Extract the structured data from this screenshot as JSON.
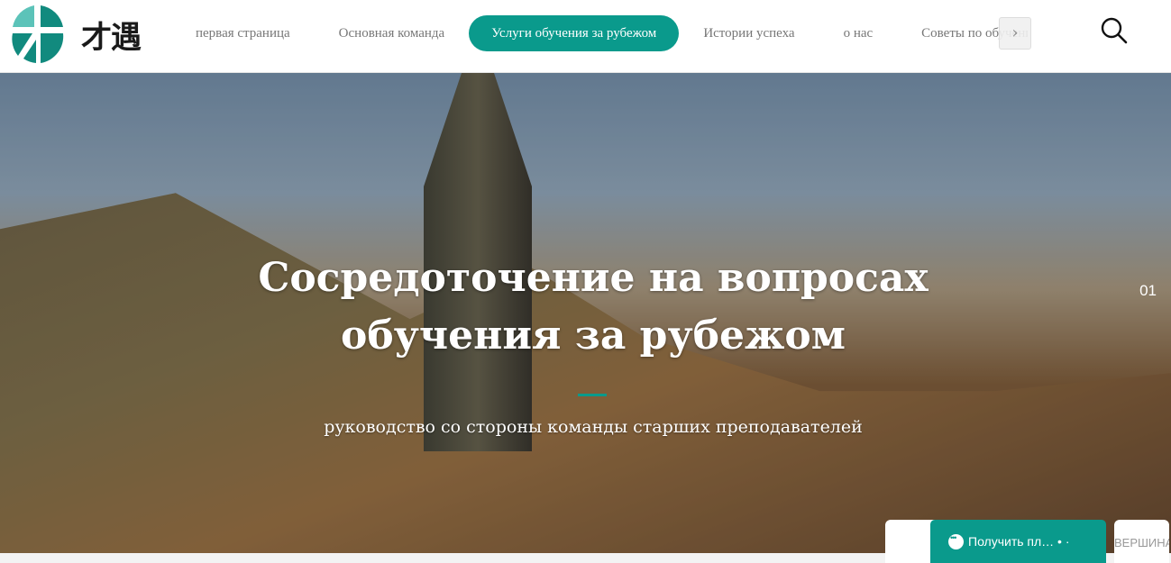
{
  "header": {
    "logo_text": "才遇",
    "nav": [
      {
        "label": "первая страница",
        "active": false
      },
      {
        "label": "Основная команда",
        "active": false
      },
      {
        "label": "Услуги обучения за рубежом",
        "active": true
      },
      {
        "label": "Истории успеха",
        "active": false
      },
      {
        "label": "о нас",
        "active": false
      },
      {
        "label": "Советы по обучению",
        "active": false
      }
    ],
    "next_icon": "chevron-right-icon",
    "search_icon": "search-icon"
  },
  "hero": {
    "title": "Сосредоточение на вопросах обучения за рубежом",
    "subtitle": "руководство со стороны команды старших преподавателей",
    "slide_number": "01"
  },
  "floating": {
    "chat_label": "Получить пл… • ·",
    "top_label": "ВЕРШИНА"
  },
  "colors": {
    "accent": "#0a9a8c"
  }
}
